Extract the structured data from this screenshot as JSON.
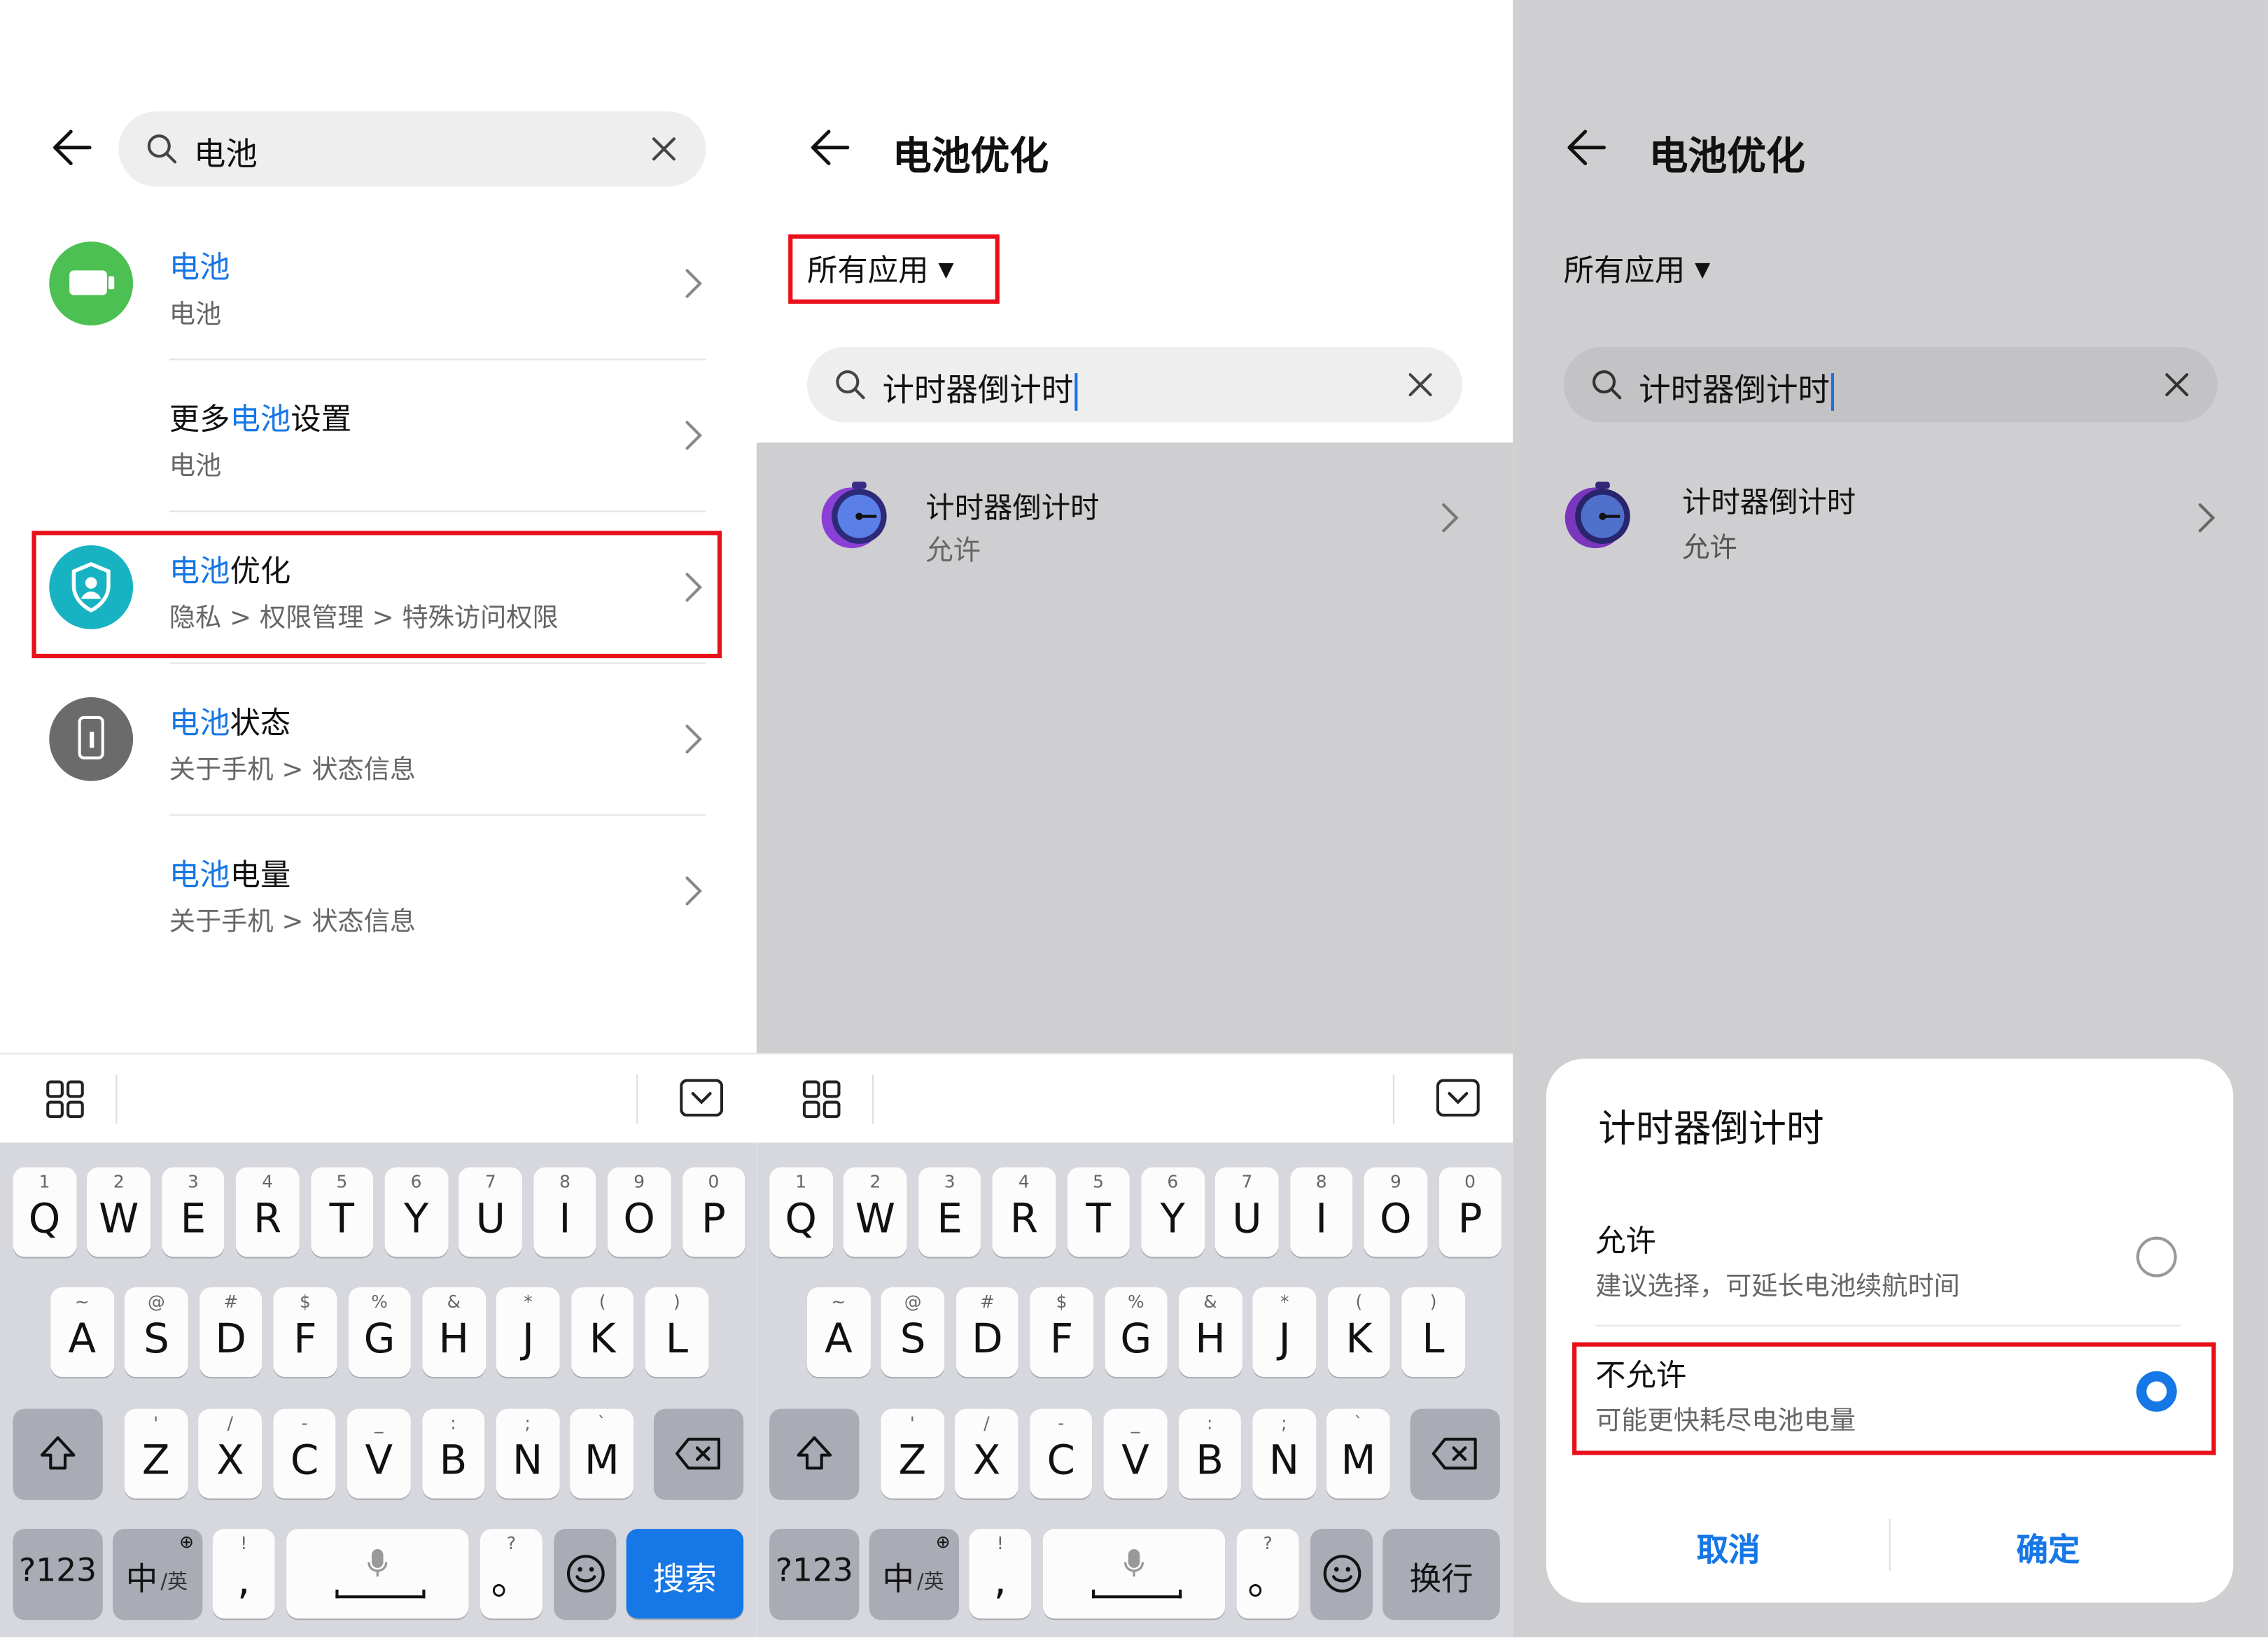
{
  "panel1": {
    "search_value": "电池",
    "results": [
      {
        "title_highlight": "电池",
        "title_rest": "",
        "subtitle": "电池"
      },
      {
        "title_prefix": "更多",
        "title_highlight": "电池",
        "title_rest": "设置",
        "subtitle": "电池"
      },
      {
        "title_highlight": "电池",
        "title_rest": "优化",
        "subtitle": "隐私 > 权限管理 > 特殊访问权限"
      },
      {
        "title_highlight": "电池",
        "title_rest": "状态",
        "subtitle": "关于手机 > 状态信息"
      },
      {
        "title_highlight": "电池",
        "title_rest": "电量",
        "subtitle": "关于手机 > 状态信息"
      }
    ],
    "enter_key": "搜索"
  },
  "panel2": {
    "title": "电池优化",
    "filter": "所有应用",
    "search_value": "计时器倒计时",
    "app": {
      "name": "计时器倒计时",
      "status": "允许"
    },
    "enter_key": "换行"
  },
  "panel3": {
    "title": "电池优化",
    "filter": "所有应用",
    "search_value": "计时器倒计时",
    "app": {
      "name": "计时器倒计时",
      "status": "允许"
    },
    "dialog": {
      "title": "计时器倒计时",
      "options": [
        {
          "label": "允许",
          "desc": "建议选择，可延长电池续航时间",
          "selected": false
        },
        {
          "label": "不允许",
          "desc": "可能更快耗尽电池电量",
          "selected": true
        }
      ],
      "cancel": "取消",
      "confirm": "确定"
    }
  },
  "keyboard": {
    "row1": [
      {
        "k": "Q",
        "s": "1"
      },
      {
        "k": "W",
        "s": "2"
      },
      {
        "k": "E",
        "s": "3"
      },
      {
        "k": "R",
        "s": "4"
      },
      {
        "k": "T",
        "s": "5"
      },
      {
        "k": "Y",
        "s": "6"
      },
      {
        "k": "U",
        "s": "7"
      },
      {
        "k": "I",
        "s": "8"
      },
      {
        "k": "O",
        "s": "9"
      },
      {
        "k": "P",
        "s": "0"
      }
    ],
    "row2": [
      {
        "k": "A",
        "s": "~"
      },
      {
        "k": "S",
        "s": "@"
      },
      {
        "k": "D",
        "s": "#"
      },
      {
        "k": "F",
        "s": "$"
      },
      {
        "k": "G",
        "s": "%"
      },
      {
        "k": "H",
        "s": "&"
      },
      {
        "k": "J",
        "s": "*"
      },
      {
        "k": "K",
        "s": "("
      },
      {
        "k": "L",
        "s": ")"
      }
    ],
    "row3": [
      {
        "k": "Z",
        "s": "'"
      },
      {
        "k": "X",
        "s": "/"
      },
      {
        "k": "C",
        "s": "-"
      },
      {
        "k": "V",
        "s": "_"
      },
      {
        "k": "B",
        "s": ":"
      },
      {
        "k": "N",
        "s": ";"
      },
      {
        "k": "M",
        "s": "`"
      }
    ],
    "sym_key": "?123",
    "lang_key": "中",
    "lang_sub": "/英",
    "comma_top": "!",
    "comma_main": ",",
    "period_top": "?",
    "period_main": "。"
  },
  "colors": {
    "accent": "#1677e6",
    "highlight_box": "#e8101a",
    "battery_green": "#4cc052",
    "teal": "#17b3c3"
  }
}
